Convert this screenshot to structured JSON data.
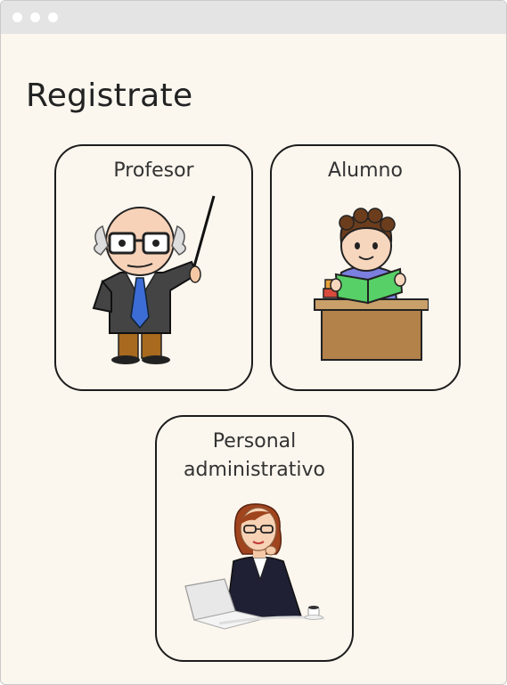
{
  "window": {
    "controls": [
      "window-dot",
      "window-dot",
      "window-dot"
    ]
  },
  "page": {
    "title": "Registrate"
  },
  "roles": [
    {
      "label": "Profesor",
      "illustration": "teacher-illustration"
    },
    {
      "label": "Alumno",
      "illustration": "student-illustration"
    },
    {
      "label": "Personal administrativo",
      "label_lines": [
        "Personal",
        "administrativo"
      ],
      "illustration": "admin-staff-illustration"
    }
  ]
}
